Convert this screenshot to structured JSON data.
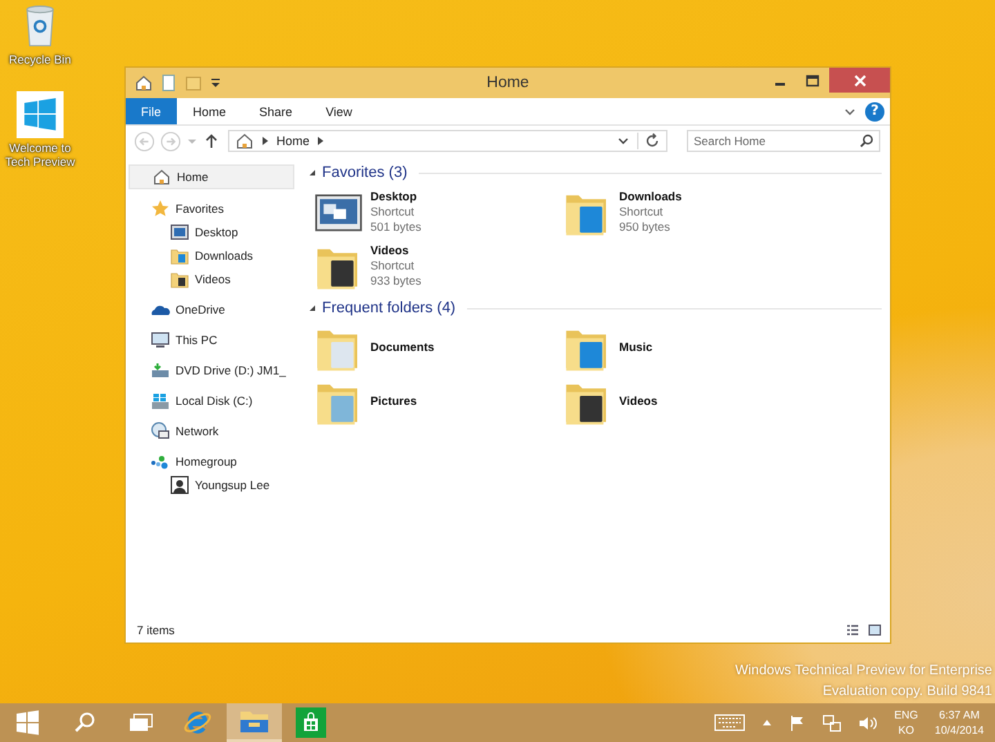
{
  "desktop_icons": [
    {
      "label": "Recycle Bin",
      "kind": "recycle"
    },
    {
      "label": "Welcome to Tech Preview",
      "kind": "windows"
    }
  ],
  "window": {
    "title": "Home"
  },
  "ribbon_tabs": [
    {
      "label": "File",
      "kind": "file"
    },
    {
      "label": "Home",
      "kind": "tab"
    },
    {
      "label": "Share",
      "kind": "tab"
    },
    {
      "label": "View",
      "kind": "tab"
    }
  ],
  "address": {
    "crumbs": [
      "Home"
    ]
  },
  "search": {
    "placeholder": "Search Home"
  },
  "help_button": "?",
  "sidebar": {
    "items": [
      {
        "label": "Home",
        "kind": "home",
        "selected": true
      },
      {
        "label": "Favorites",
        "kind": "star",
        "selected": false,
        "children": [
          {
            "label": "Desktop",
            "kind": "desktop",
            "selected": false
          },
          {
            "label": "Downloads",
            "kind": "downloads",
            "selected": false
          },
          {
            "label": "Videos",
            "kind": "videos",
            "selected": false
          }
        ]
      },
      {
        "label": "OneDrive",
        "kind": "cloud",
        "selected": false
      },
      {
        "label": "This PC",
        "kind": "pc",
        "selected": false
      },
      {
        "label": "DVD Drive (D:) JM1_",
        "kind": "dvd",
        "selected": false
      },
      {
        "label": "Local Disk (C:)",
        "kind": "disk",
        "selected": false
      },
      {
        "label": "Network",
        "kind": "network",
        "selected": false
      },
      {
        "label": "Homegroup",
        "kind": "homegroup",
        "selected": false,
        "children": [
          {
            "label": "Youngsup Lee",
            "kind": "user",
            "selected": false
          }
        ]
      }
    ]
  },
  "groups": [
    {
      "title": "Favorites (3)",
      "expanded": true,
      "items": [
        {
          "name": "Desktop",
          "type": "Shortcut",
          "size": "501 bytes",
          "kind": "desktop"
        },
        {
          "name": "Downloads",
          "type": "Shortcut",
          "size": "950 bytes",
          "kind": "downloads"
        },
        {
          "name": "Videos",
          "type": "Shortcut",
          "size": "933 bytes",
          "kind": "videos"
        }
      ]
    },
    {
      "title": "Frequent folders (4)",
      "expanded": true,
      "items": [
        {
          "name": "Documents",
          "kind": "documents"
        },
        {
          "name": "Music",
          "kind": "music"
        },
        {
          "name": "Pictures",
          "kind": "pictures"
        },
        {
          "name": "Videos",
          "kind": "videos"
        }
      ]
    }
  ],
  "status_bar": {
    "text": "7 items"
  },
  "watermark_lines": [
    "Windows Technical Preview for Enterprise",
    "Evaluation copy. Build 9841"
  ],
  "taskbar": {
    "items": [
      {
        "kind": "start",
        "selected": false
      },
      {
        "kind": "search",
        "selected": false
      },
      {
        "kind": "taskview",
        "selected": false
      },
      {
        "kind": "ie",
        "selected": false
      },
      {
        "kind": "explorer",
        "selected": true
      },
      {
        "kind": "store",
        "selected": false
      }
    ],
    "language": [
      "ENG",
      "KO"
    ],
    "time": "6:37 AM",
    "date": "10/4/2014"
  }
}
